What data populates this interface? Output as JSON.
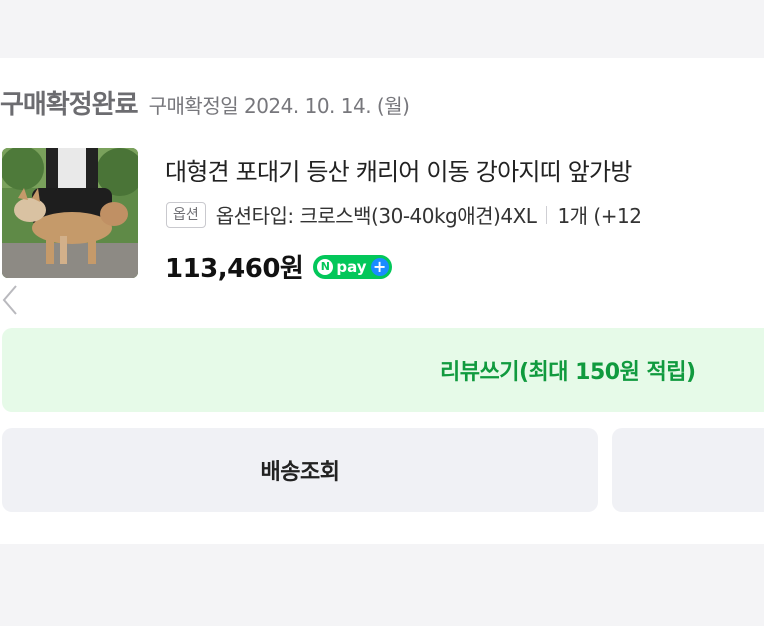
{
  "order": {
    "status": "구매확정완료",
    "confirm_date": "구매확정일 2024. 10. 14. (월)"
  },
  "product": {
    "title": "대형견 포대기 등산 캐리어 이동 강아지띠 앞가방",
    "option_badge": "옵션",
    "option_text": "옵션타입: 크로스백(30-40kg애견)4XL",
    "quantity_text": "1개 (+12",
    "price": "113,460원"
  },
  "npay": {
    "n": "N",
    "label": "pay",
    "plus": "+"
  },
  "actions": {
    "review_label": "리뷰쓰기(최대 150원 적립)",
    "track_label": "배송조회"
  },
  "icons": {
    "prev": "chevron-left-icon"
  },
  "colors": {
    "background": "#f4f4f6",
    "card": "#ffffff",
    "review_bg": "#e6fae8",
    "review_text": "#109a3e",
    "npay_green": "#03c75a",
    "npay_blue": "#1a8cff",
    "button_gray": "#f0f1f5"
  }
}
